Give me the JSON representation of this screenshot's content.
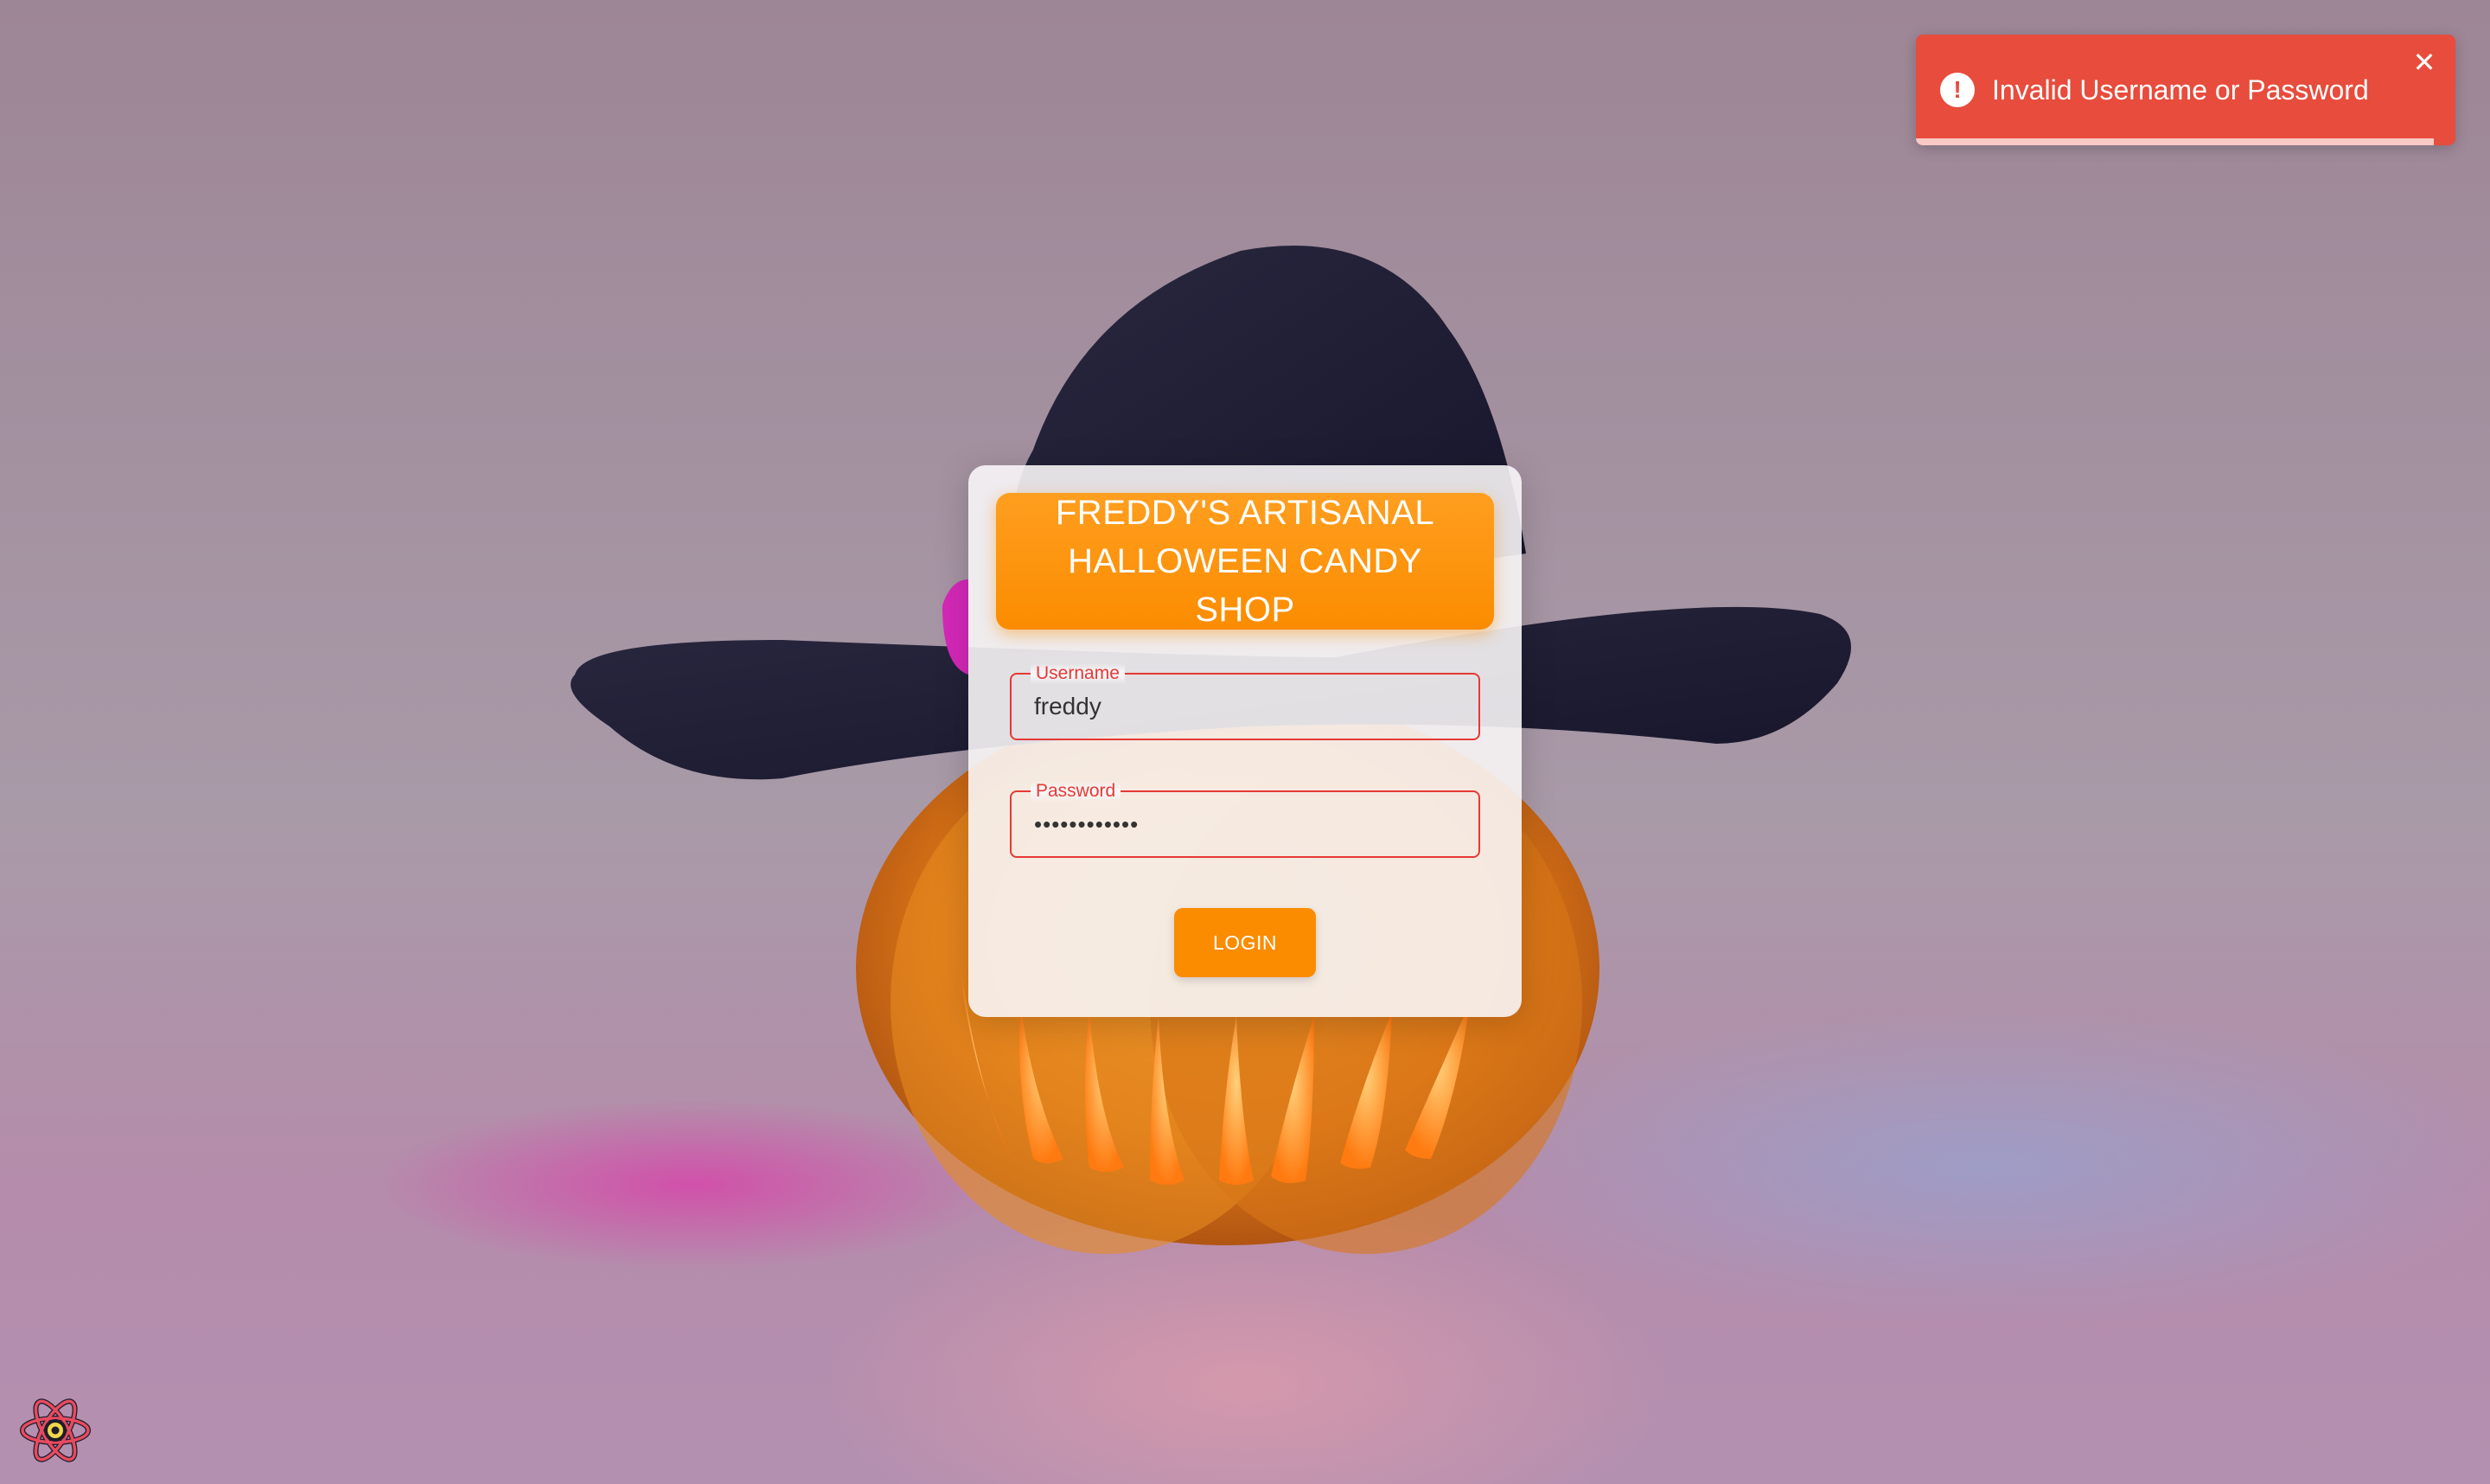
{
  "app": {
    "title": "FREDDY'S ARTISANAL HALLOWEEN CANDY SHOP"
  },
  "login": {
    "username_label": "Username",
    "username_value": "freddy",
    "password_label": "Password",
    "password_value": "••••••••••••",
    "button_label": "LOGIN"
  },
  "toast": {
    "message": "Invalid Username or Password",
    "icon": "exclamation-icon",
    "close_icon": "close-icon",
    "progress_fraction": 0.96,
    "color": "#e74c3c"
  },
  "badge": {
    "icon": "react-devtools-icon"
  },
  "colors": {
    "accent": "#fb8c00",
    "error": "#e53935"
  }
}
